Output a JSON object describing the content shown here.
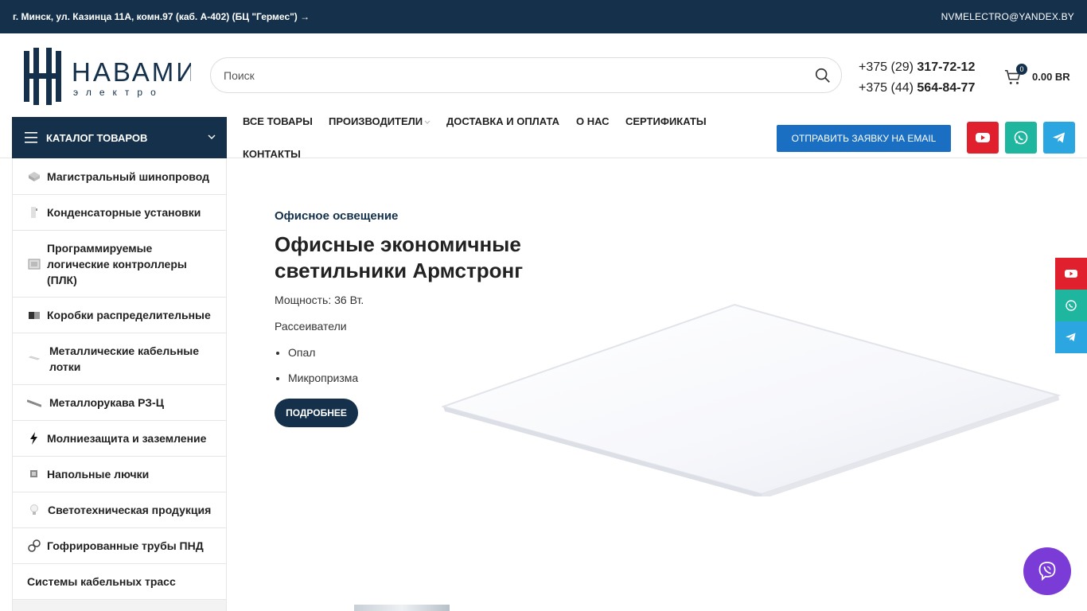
{
  "topbar": {
    "address": "г. Минск, ул. Казинца 11А, комн.97 (каб. А-402) (БЦ \"Гермес\") →",
    "email": "NVMELECTRO@YANDEX.BY"
  },
  "header": {
    "logo_main": "НАВАМИ",
    "logo_sub": "электро",
    "search_placeholder": "Поиск",
    "phone1_prefix": "+375 (29)",
    "phone1_number": "317-72-12",
    "phone2_prefix": "+375 (44)",
    "phone2_number": "564-84-77",
    "cart_count": "0",
    "cart_total": "0.00 BR"
  },
  "nav": {
    "catalog_label": "КАТАЛОГ ТОВАРОВ",
    "items": [
      "ВСЕ ТОВАРЫ",
      "ПРОИЗВОДИТЕЛИ",
      "ДОСТАВКА И ОПЛАТА",
      "О НАС",
      "СЕРТИФИКАТЫ",
      "КОНТАКТЫ"
    ],
    "email_button": "ОТПРАВИТЬ ЗАЯВКУ НА EMAIL",
    "colors": {
      "youtube": "#e1202d",
      "whatsapp": "#1fb6a0",
      "telegram": "#2ca6e0",
      "brand": "#14304a"
    }
  },
  "sidebar": {
    "categories": [
      "Магистральный шинопровод",
      "Конденсаторные установки",
      "Программируемые логические контроллеры (ПЛК)",
      "Коробки распределительные",
      "Металлические кабельные лотки",
      "Металлорукава РЗ-Ц",
      "Молниезащита и заземление",
      "Напольные лючки",
      "Светотехническая продукция",
      "Гофрированные трубы ПНД",
      "Системы кабельных трасс"
    ]
  },
  "hero": {
    "eyebrow": "Офисное освещение",
    "title": "Офисные экономичные светильники Армстронг",
    "power": "Мощность: 36 Вт.",
    "diffusers_label": "Рассеиватели",
    "diffusers": [
      "Опал",
      "Микропризма"
    ],
    "button": "ПОДРОБНЕЕ"
  }
}
